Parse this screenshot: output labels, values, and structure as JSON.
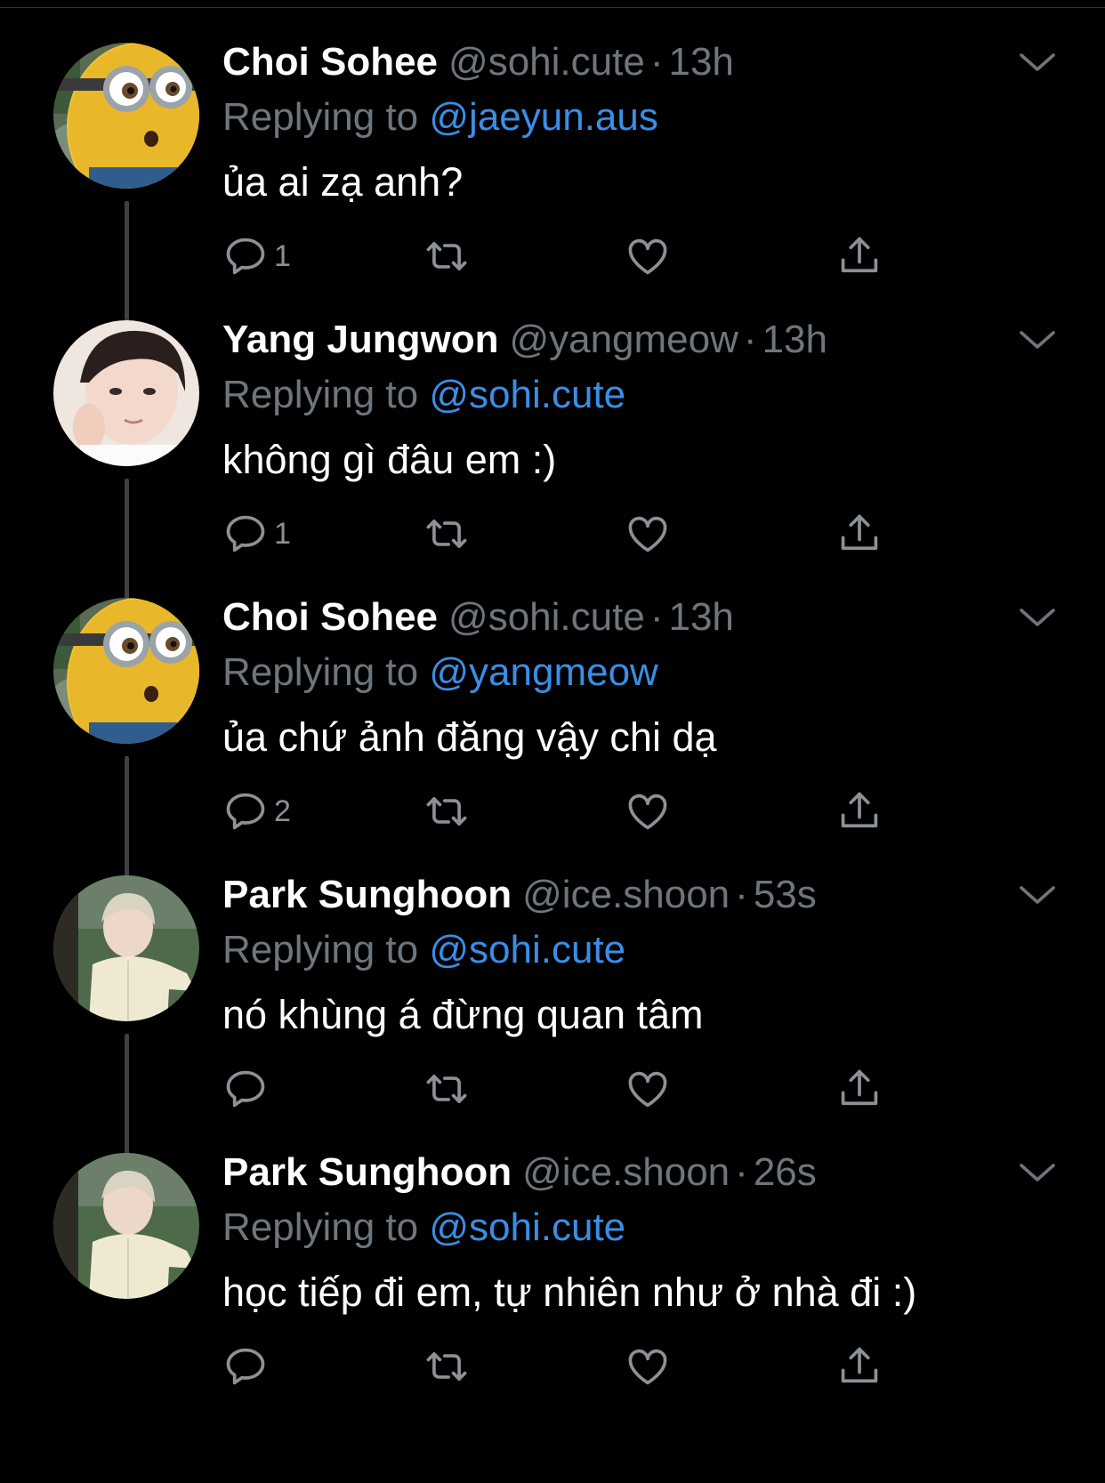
{
  "colors": {
    "background": "#000000",
    "name": "#ffffff",
    "muted": "#6e767d",
    "link": "#3a8ee6",
    "thread_line": "#3d4145"
  },
  "icons": {
    "reply": "reply-icon",
    "retweet": "retweet-icon",
    "like": "heart-icon",
    "share": "share-icon",
    "more": "chevron-down-icon"
  },
  "tweets": [
    {
      "name": "Choi Sohee",
      "handle": "@sohi.cute",
      "separator": "·",
      "time": "13h",
      "replying_prefix": "Replying to",
      "replying_to": "@jaeyun.aus",
      "text": "ủa ai zạ anh?",
      "reply_count": "1",
      "avatar": "minion"
    },
    {
      "name": "Yang Jungwon",
      "handle": "@yangmeow",
      "separator": "·",
      "time": "13h",
      "replying_prefix": "Replying to",
      "replying_to": "@sohi.cute",
      "text": "không gì đâu em :)",
      "reply_count": "1",
      "avatar": "person-dark-hair"
    },
    {
      "name": "Choi Sohee",
      "handle": "@sohi.cute",
      "separator": "·",
      "time": "13h",
      "replying_prefix": "Replying to",
      "replying_to": "@yangmeow",
      "text": "ủa chứ ảnh đăng vậy chi dạ",
      "reply_count": "2",
      "avatar": "minion"
    },
    {
      "name": "Park Sunghoon",
      "handle": "@ice.shoon",
      "separator": "·",
      "time": "53s",
      "replying_prefix": "Replying to",
      "replying_to": "@sohi.cute",
      "text": "nó khùng á đừng quan tâm",
      "reply_count": "",
      "avatar": "person-light-hair"
    },
    {
      "name": "Park Sunghoon",
      "handle": "@ice.shoon",
      "separator": "·",
      "time": "26s",
      "replying_prefix": "Replying to",
      "replying_to": "@sohi.cute",
      "text": "học tiếp đi em, tự nhiên như ở nhà đi :)",
      "reply_count": "",
      "avatar": "person-light-hair"
    }
  ]
}
